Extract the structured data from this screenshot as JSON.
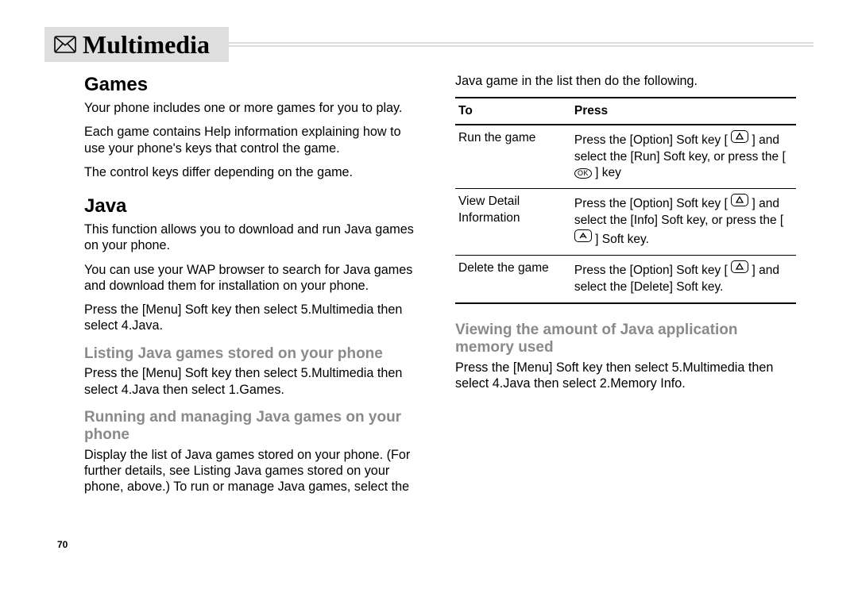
{
  "header": {
    "icon_name": "envelope-icon",
    "title": "Multimedia"
  },
  "page_number": "70",
  "left": {
    "h_games": "Games",
    "games_p1": "Your phone includes one or more games for you to play.",
    "games_p2": "Each game contains Help information explaining how to use your phone's keys that control the game.",
    "games_p3": "The control keys differ depending on the game.",
    "h_java": "Java",
    "java_p1": "This function allows you to download and run Java games on your phone.",
    "java_p2": "You can use your WAP browser to search for Java games and download them for installation on your phone.",
    "java_p3": "Press the [Menu] Soft key then select 5.Multimedia then select 4.Java.",
    "h_listing": "Listing Java games stored on your phone",
    "listing_p1": "Press the [Menu] Soft key then select 5.Multimedia then select 4.Java then select 1.Games.",
    "h_running": "Running and managing Java games on your phone",
    "running_p1": "Display the list of Java games stored on your phone. (For further details, see Listing Java games stored on your phone, above.) To run or manage Java games, select the"
  },
  "right": {
    "intro": "Java game in the list then do the following.",
    "table": {
      "head_to": "To",
      "head_press": "Press",
      "rows": [
        {
          "to": "Run the game",
          "press_a": "Press the [Option] Soft key [",
          "press_b": "] and select the [Run] Soft key, or press the [",
          "press_c": "] key"
        },
        {
          "to": "View Detail Information",
          "press_a": "Press the [Option] Soft key [",
          "press_b": "] and select the [Info] Soft key, or press the [",
          "press_c": "] Soft key."
        },
        {
          "to": "Delete the game",
          "press_a": "Press the [Option] Soft key [",
          "press_b": "] and select the [Delete] Soft key.",
          "press_c": ""
        }
      ]
    },
    "h_viewing": "Viewing the amount of Java application memory used",
    "viewing_p1": "Press the [Menu] Soft key then select 5.Multimedia then select 4.Java then select 2.Memory Info."
  }
}
